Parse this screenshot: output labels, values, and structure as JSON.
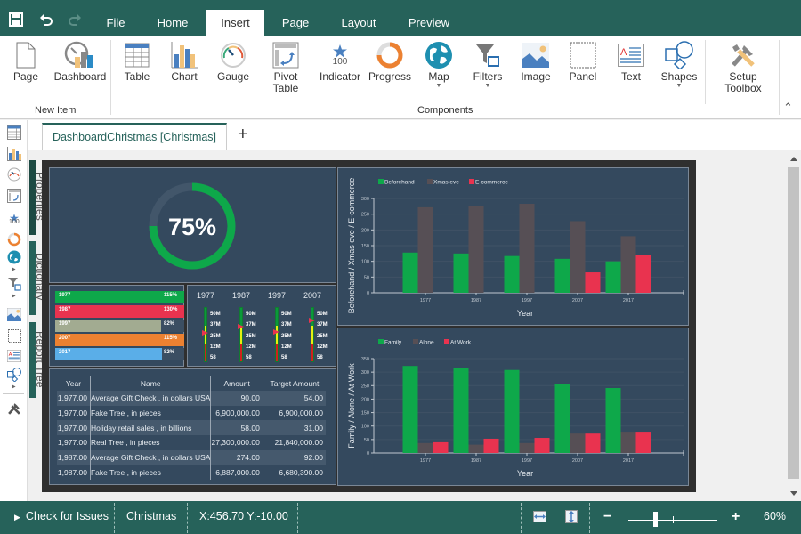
{
  "titlebar": {
    "save_icon": "save-icon",
    "undo_icon": "undo-icon",
    "redo_icon": "redo-icon",
    "menu_tabs": [
      {
        "label": "File",
        "active": false
      },
      {
        "label": "Home",
        "active": false
      },
      {
        "label": "Insert",
        "active": true
      },
      {
        "label": "Page",
        "active": false
      },
      {
        "label": "Layout",
        "active": false
      },
      {
        "label": "Preview",
        "active": false
      }
    ]
  },
  "ribbon": {
    "groups": {
      "new_item": "New Item",
      "components": "Components"
    },
    "buttons": {
      "page": "Page",
      "dashboard": "Dashboard",
      "table": "Table",
      "chart": "Chart",
      "gauge": "Gauge",
      "pivot_table_1": "Pivot",
      "pivot_table_2": "Table",
      "indicator": "Indicator",
      "indicator_value": "100",
      "progress": "Progress",
      "map": "Map",
      "filters": "Filters",
      "image": "Image",
      "panel": "Panel",
      "text": "Text",
      "shapes": "Shapes",
      "setup_toolbox_1": "Setup",
      "setup_toolbox_2": "Toolbox"
    },
    "dropdown_glyph": "▼",
    "collapse_glyph": "⌃"
  },
  "side_panels": {
    "properties": "Properties",
    "dictionary": "Dictionary",
    "report_tree": "Report Tree",
    "indicator_small": "100"
  },
  "document": {
    "tab_label": "DashboardChristmas [Christmas]",
    "add_tab": "+"
  },
  "dashboard": {
    "progress": {
      "value_label": "75%",
      "fraction": 0.75,
      "ring_color": "#0ea84a"
    },
    "bar_indicators": [
      {
        "label": "1977",
        "pct_label": "115%",
        "fill": 1.0,
        "color": "#0ea84a"
      },
      {
        "label": "1987",
        "pct_label": "130%",
        "fill": 1.0,
        "color": "#e9334f"
      },
      {
        "label": "1997",
        "pct_label": "82%",
        "fill": 0.82,
        "color": "#a2ab91"
      },
      {
        "label": "2007",
        "pct_label": "115%",
        "fill": 1.0,
        "color": "#ec8131"
      },
      {
        "label": "2017",
        "pct_label": "82%",
        "fill": 0.83,
        "color": "#5aaee8"
      }
    ],
    "linear_gauges": {
      "ticks": [
        "50M",
        "37M",
        "25M",
        "12M",
        "58"
      ],
      "items": [
        {
          "year": "1977",
          "marker": 0.54
        },
        {
          "year": "1987",
          "marker": 0.64
        },
        {
          "year": "1997",
          "marker": 0.55
        },
        {
          "year": "2007",
          "marker": 0.76
        }
      ]
    },
    "table": {
      "columns": [
        "Year",
        "Name",
        "Amount",
        "Target Amount"
      ],
      "rows": [
        [
          "1,977.00",
          "Average Gift Check  , in dollars USA",
          "90.00",
          "54.00"
        ],
        [
          "1,977.00",
          "Fake Tree , in pieces",
          "6,900,000.00",
          "6,900,000.00"
        ],
        [
          "1,977.00",
          "Holiday retail sales  , in billions",
          "58.00",
          "31.00"
        ],
        [
          "1,977.00",
          "Real Tree , in pieces",
          "27,300,000.00",
          "21,840,000.00"
        ],
        [
          "1,987.00",
          "Average Gift Check  , in dollars USA",
          "274.00",
          "92.00"
        ],
        [
          "1,987.00",
          "Fake Tree , in pieces",
          "6,887,000.00",
          "6,680,390.00"
        ]
      ]
    }
  },
  "chart_data": [
    {
      "type": "bar",
      "title": "",
      "xlabel": "Year",
      "ylabel": "Beforehand / Xmas eve / E-commerce",
      "categories": [
        "1977",
        "1987",
        "1997",
        "2007",
        "2017"
      ],
      "ylim": [
        0,
        300
      ],
      "yticks": [
        0,
        50,
        100,
        150,
        200,
        250,
        300
      ],
      "grid": true,
      "legend": "top-left",
      "series": [
        {
          "name": "Beforehand",
          "color": "#0ea84a",
          "values": [
            128,
            125,
            117,
            108,
            100
          ]
        },
        {
          "name": "Xmas eve",
          "color": "#564f55",
          "values": [
            272,
            275,
            283,
            228,
            180
          ]
        },
        {
          "name": "E-commerce",
          "color": "#e9334f",
          "values": [
            0,
            0,
            0,
            65,
            120
          ]
        }
      ]
    },
    {
      "type": "bar",
      "title": "",
      "xlabel": "Year",
      "ylabel": "Family / Alone / At Work",
      "categories": [
        "1977",
        "1987",
        "1997",
        "2007",
        "2017"
      ],
      "ylim": [
        0,
        350
      ],
      "yticks": [
        0,
        50,
        100,
        150,
        200,
        250,
        300,
        350
      ],
      "grid": true,
      "legend": "top-left",
      "series": [
        {
          "name": "Family",
          "color": "#0ea84a",
          "values": [
            323,
            314,
            308,
            257,
            241
          ]
        },
        {
          "name": "Alone",
          "color": "#564f55",
          "values": [
            37,
            31,
            37,
            72,
            79
          ]
        },
        {
          "name": "At Work",
          "color": "#e9334f",
          "values": [
            40,
            53,
            56,
            72,
            79
          ]
        }
      ]
    }
  ],
  "statusbar": {
    "check_issues": "Check for Issues",
    "page_name": "Christmas",
    "coords": "X:456.70 Y:-10.00",
    "zoom_minus": "−",
    "zoom_plus": "+",
    "zoom_label": "60%",
    "zoom_fraction": 0.3
  }
}
